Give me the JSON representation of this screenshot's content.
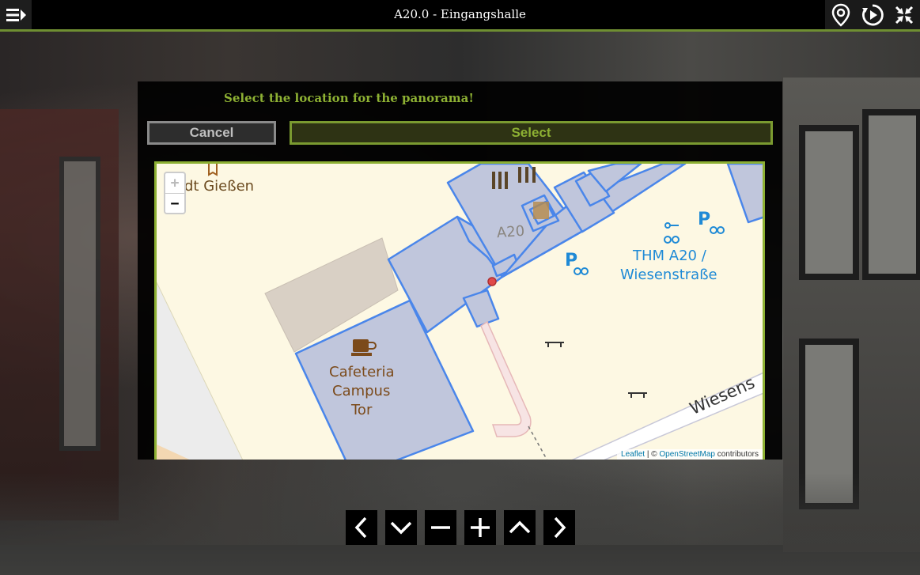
{
  "header": {
    "title": "A20.0 - Eingangshalle",
    "icons": [
      "menu-icon",
      "location-pin-icon",
      "play-icon",
      "fullscreen-icon"
    ]
  },
  "dialog": {
    "title": "Select the location for the panorama!",
    "cancel_label": "Cancel",
    "select_label": "Select"
  },
  "map": {
    "zoom_in": "+",
    "zoom_out": "−",
    "labels": {
      "town": "dt Gießen",
      "building": "A20",
      "campus_line1": "THM A20 /",
      "campus_line2": "Wiesenstraße",
      "cafe_line1": "Cafeteria",
      "cafe_line2": "Campus",
      "cafe_line3": "Tor",
      "street": "Wiesens"
    },
    "attribution": {
      "leaflet": "Leaflet",
      "separator": " | © ",
      "osm": "OpenStreetMap",
      "suffix": " contributors"
    }
  },
  "bottom_nav": {
    "buttons": [
      "chevron-left-icon",
      "chevron-down-icon",
      "minus-icon",
      "plus-icon",
      "chevron-up-icon",
      "chevron-right-icon"
    ]
  },
  "colors": {
    "accent": "#8db033",
    "building_fill": "#c0c6dc",
    "building_stroke": "#4a86ea",
    "map_bg": "#fdf8e3",
    "poi_blue": "#1f8ad6",
    "poi_brown": "#7b4a1a"
  }
}
